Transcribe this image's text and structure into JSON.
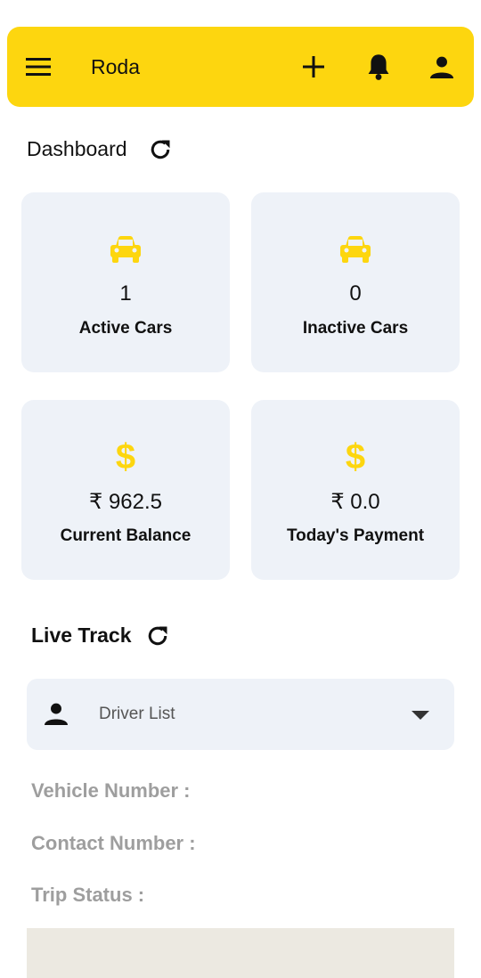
{
  "appbar": {
    "title": "Roda",
    "icons": [
      "menu-icon",
      "add-icon",
      "bell-icon",
      "account-icon"
    ],
    "color": "#fdd60f"
  },
  "dashboard": {
    "title": "Dashboard",
    "cards": [
      {
        "icon": "car-icon",
        "value": "1",
        "label": "Active Cars"
      },
      {
        "icon": "car-icon",
        "value": "0",
        "label": "Inactive Cars"
      },
      {
        "icon": "dollar-icon",
        "symbol": "$",
        "value": "₹ 962.5",
        "label": "Current Balance"
      },
      {
        "icon": "dollar-icon",
        "symbol": "$",
        "value": "₹ 0.0",
        "label": "Today's Payment"
      }
    ]
  },
  "live_track": {
    "title": "Live Track",
    "driver_select": {
      "placeholder": "Driver List",
      "icon": "person-icon"
    },
    "fields": {
      "vehicle_number": "Vehicle Number :",
      "contact_number": "Contact Number :",
      "trip_status": "Trip Status :"
    }
  },
  "colors": {
    "accent": "#fdd60f",
    "card_bg": "#eef2f8",
    "muted_text": "#9e9e9e"
  }
}
